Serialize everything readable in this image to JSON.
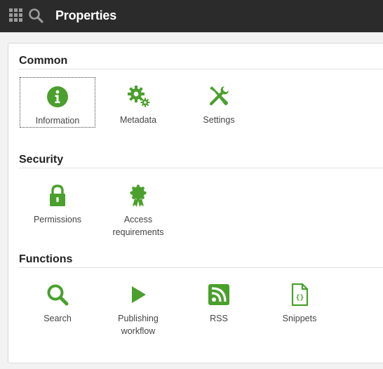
{
  "header": {
    "title": "Properties",
    "apps_icon": "apps-grid-icon",
    "search_icon": "search-icon"
  },
  "accent_color": "#4aa02c",
  "sections": {
    "common": {
      "title": "Common",
      "items": [
        {
          "label": "Information",
          "icon": "info-icon",
          "focused": true
        },
        {
          "label": "Metadata",
          "icon": "gears-icon"
        },
        {
          "label": "Settings",
          "icon": "tools-icon"
        }
      ]
    },
    "security": {
      "title": "Security",
      "items": [
        {
          "label": "Permissions",
          "icon": "lock-icon"
        },
        {
          "label": "Access\nrequirements",
          "icon": "badge-icon"
        }
      ]
    },
    "functions": {
      "title": "Functions",
      "items": [
        {
          "label": "Search",
          "icon": "search-icon"
        },
        {
          "label": "Publishing\nworkflow",
          "icon": "play-icon"
        },
        {
          "label": "RSS",
          "icon": "rss-icon"
        },
        {
          "label": "Snippets",
          "icon": "snippet-file-icon"
        }
      ]
    }
  }
}
